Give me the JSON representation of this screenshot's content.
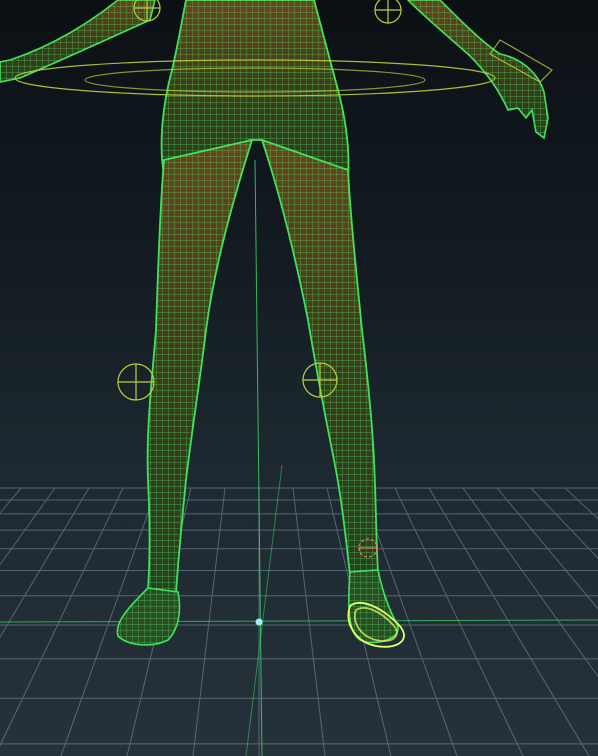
{
  "viewport": {
    "view": "front",
    "mode": "wireframe-on-shaded",
    "grid_visible": true
  },
  "colors": {
    "background_top": "#0b1014",
    "background_bottom": "#26323b",
    "grid_line": "#7f96a6",
    "wireframe": "#3ee35a",
    "mesh_fill": "#5a3a1c",
    "rig_control": "#b7d23c",
    "selected_control": "#e8ff6a",
    "axis_line": "#39e06a",
    "manipulator": "#ff7060",
    "pivot": "#a8e8ff"
  },
  "character": {
    "visible_parts": [
      "left-arm",
      "right-arm",
      "torso",
      "left-leg",
      "right-leg",
      "left-foot",
      "right-foot"
    ]
  },
  "rig": {
    "controls": [
      "shoulder-control-left",
      "shoulder-control-right",
      "hip-control",
      "knee-control-left",
      "knee-control-right",
      "ankle-control-right",
      "foot-control-right-selected"
    ]
  }
}
